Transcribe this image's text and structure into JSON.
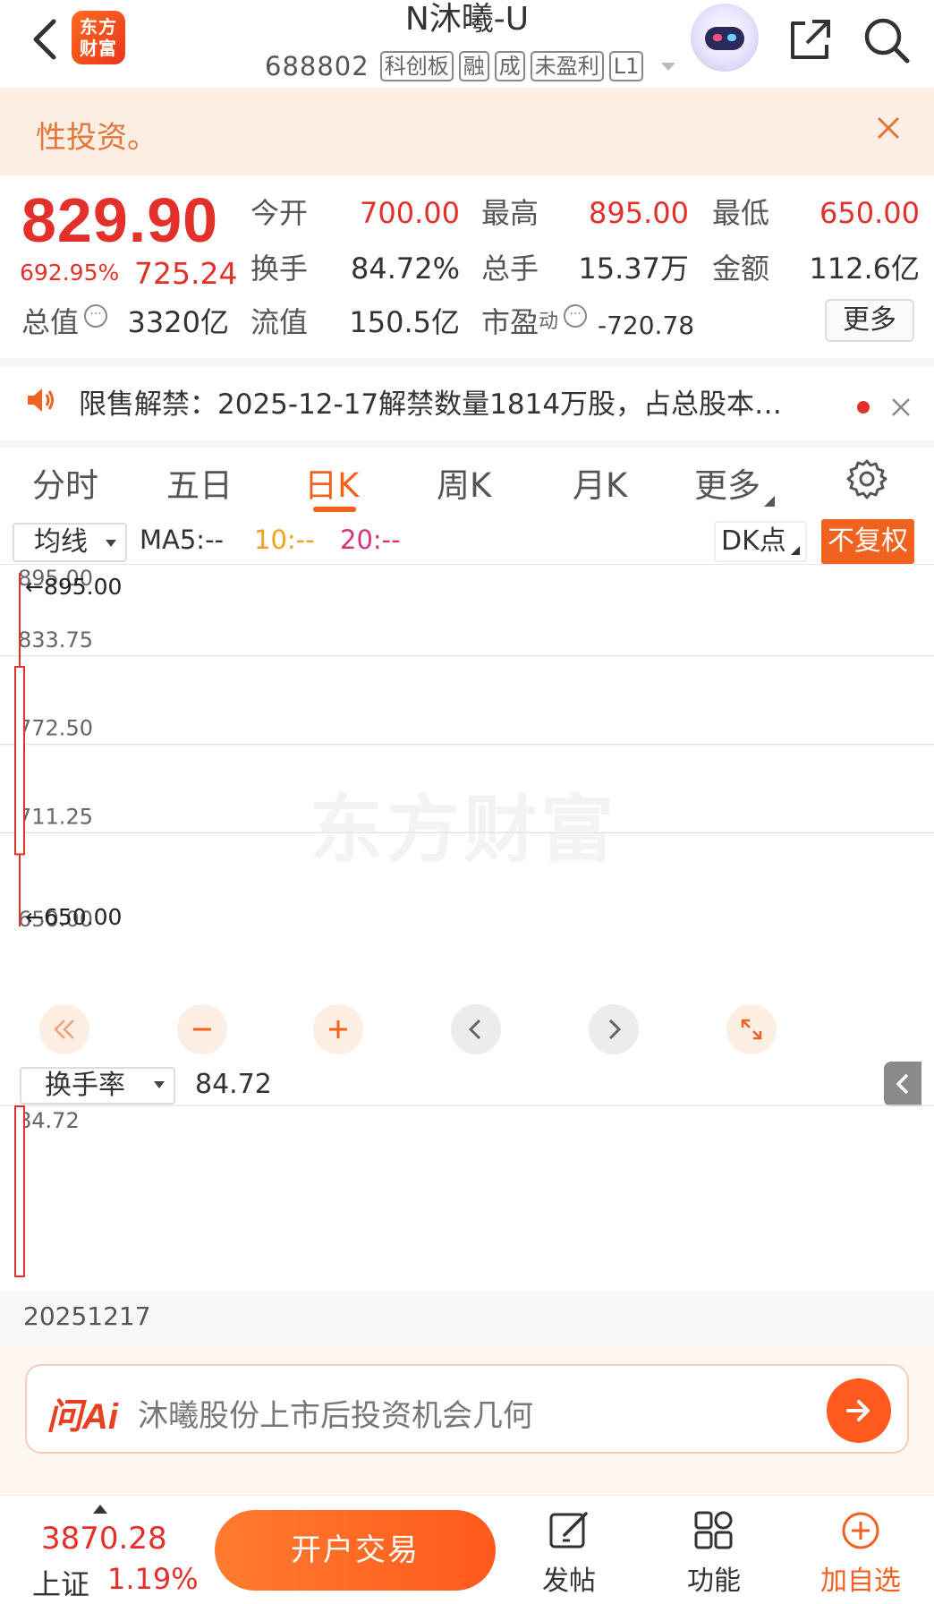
{
  "header": {
    "logo_line1": "东方",
    "logo_line2": "财富",
    "stock_name": "N沐曦-U",
    "stock_code": "688802",
    "tags": [
      "科创板",
      "融",
      "成",
      "未盈利",
      "L1"
    ]
  },
  "banner": {
    "text": "性投资。"
  },
  "quote": {
    "price": "829.90",
    "change_pct": "692.95%",
    "change": "725.24",
    "fields": [
      {
        "label": "今开",
        "value": "700.00",
        "color": "red"
      },
      {
        "label": "最高",
        "value": "895.00",
        "color": "red"
      },
      {
        "label": "最低",
        "value": "650.00",
        "color": "red"
      },
      {
        "label": "换手",
        "value": "84.72%"
      },
      {
        "label": "总手",
        "value": "15.37万"
      },
      {
        "label": "金额",
        "value": "112.6亿"
      },
      {
        "label": "总值",
        "value": "3320亿"
      },
      {
        "label": "流值",
        "value": "150.5亿"
      },
      {
        "label": "市盈",
        "sup": "动",
        "value": "-720.78"
      }
    ],
    "more_label": "更多"
  },
  "notice": {
    "text": "限售解禁：2025-12-17解禁数量1814万股，占总股本…"
  },
  "tabs": [
    "分时",
    "五日",
    "日K",
    "周K",
    "月K",
    "更多"
  ],
  "active_tab": "日K",
  "toolbar": {
    "ma_select": "均线",
    "ma5": "MA5:--",
    "ma10": "10:--",
    "ma20": "20:--",
    "dk_label": "DK点",
    "fq_label": "不复权"
  },
  "chart": {
    "y_ticks": [
      "895.00",
      "833.75",
      "772.50",
      "711.25",
      "650.00"
    ],
    "high_marker": "←895.00",
    "low_marker": "←650.00",
    "watermark": "东方财富"
  },
  "chart_data": {
    "type": "candlestick",
    "x": [
      "20251217"
    ],
    "open": [
      700.0
    ],
    "high": [
      895.0
    ],
    "low": [
      650.0
    ],
    "close": [
      829.9
    ],
    "ylim": [
      650.0,
      895.0
    ],
    "indicator": {
      "name": "换手率",
      "values": [
        84.72
      ],
      "ylim": [
        0,
        84.72
      ]
    }
  },
  "sub_chart": {
    "select": "换手率",
    "value": "84.72",
    "y_tick": "84.72",
    "date": "20251217"
  },
  "ai": {
    "logo": "问Ai",
    "placeholder": "沐曦股份上市后投资机会几何"
  },
  "bottom": {
    "index_value": "3870.28",
    "index_name": "上证",
    "index_pct": "1.19%",
    "trade_label": "开户交易",
    "nav": [
      {
        "icon": "compose-icon",
        "label": "发帖"
      },
      {
        "icon": "grid-icon",
        "label": "功能"
      },
      {
        "icon": "add-circle-icon",
        "label": "加自选"
      }
    ]
  },
  "colors": {
    "up_red": "#e3302b",
    "accent_orange": "#f0621e",
    "banner_bg": "#fdeee4"
  }
}
